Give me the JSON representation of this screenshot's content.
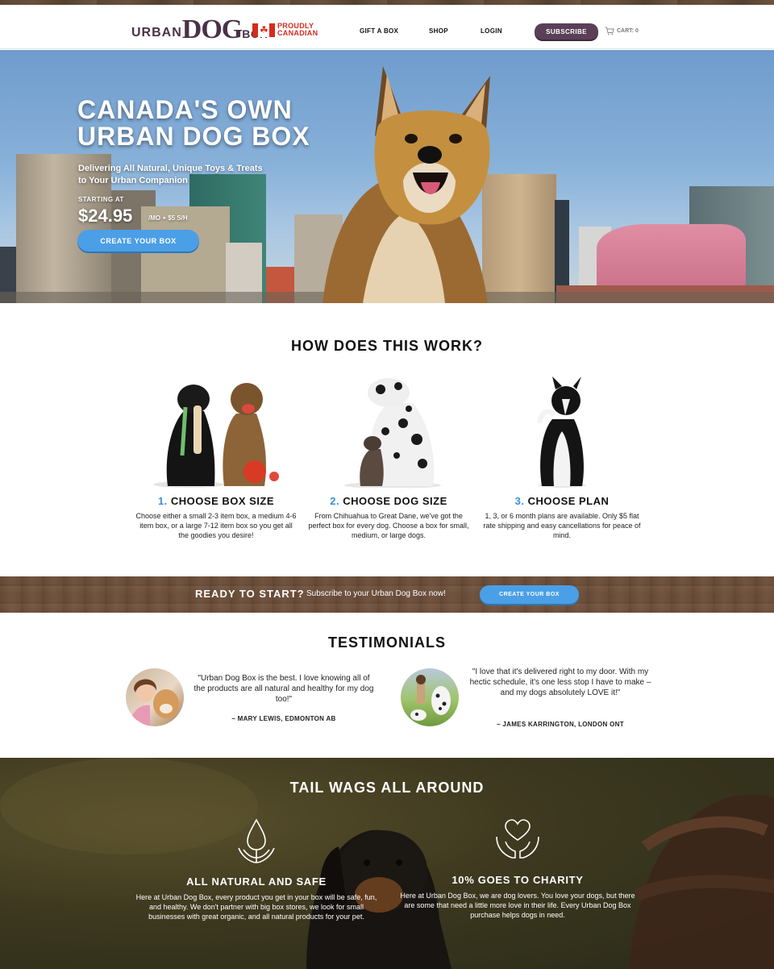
{
  "header": {
    "logo": {
      "urban": "URBAN",
      "dog": "DOG",
      "box": "BOX"
    },
    "badge": {
      "line1": "PROUDLY",
      "line2": "CANADIAN",
      "icon": "canada-flag-icon"
    },
    "nav": [
      "GIFT A BOX",
      "SHOP",
      "LOGIN"
    ],
    "subscribe_label": "SUBSCRIBE",
    "cart_label": "CART: 0",
    "cart_icon": "cart-icon"
  },
  "hero": {
    "title_line1": "CANADA'S OWN",
    "title_line2": "URBAN DOG BOX",
    "subtitle_line1": "Delivering All Natural, Unique Toys & Treats",
    "subtitle_line2": "to Your Urban Companion",
    "starting_at": "STARTING AT",
    "price": "$24.95",
    "price_suffix": "/MO + $5 S/H",
    "cta": "CREATE YOUR BOX"
  },
  "how": {
    "title": "HOW DOES THIS WORK?",
    "steps": [
      {
        "num": "1.",
        "title": "CHOOSE BOX SIZE",
        "body": "Choose either a small 2-3 item box, a medium 4-6 item box, or a large 7-12 item box so you get all the goodies you desire!"
      },
      {
        "num": "2.",
        "title": "CHOOSE DOG SIZE",
        "body": "From Chihuahua to Great Dane, we've got the perfect box for every dog. Choose a box for small, medium, or large dogs."
      },
      {
        "num": "3.",
        "title": "CHOOSE PLAN",
        "body": "1, 3, or 6 month plans are available. Only $5 flat rate shipping and easy cancellations for peace of mind."
      }
    ]
  },
  "ready": {
    "strong": "READY TO START?",
    "text": "Subscribe to your Urban Dog Box now!",
    "cta": "CREATE YOUR BOX"
  },
  "testimonials": {
    "title": "TESTIMONIALS",
    "items": [
      {
        "quote": "\"Urban Dog Box is the best. I love knowing all of the products are all natural and healthy for my dog too!\"",
        "author": "– MARY LEWIS, EDMONTON AB"
      },
      {
        "quote": "\"I love that it's delivered right to my door. With my hectic schedule, it's one less stop I have to make – and my dogs absolutely LOVE it!\"",
        "author": "– JAMES KARRINGTON, LONDON ONT"
      }
    ]
  },
  "tail": {
    "title": "TAIL WAGS ALL AROUND",
    "features": [
      {
        "icon": "water-drop-leaf-icon",
        "title": "ALL NATURAL AND SAFE",
        "body": "Here at Urban Dog Box, every product you get in your box will be safe, fun, and healthy. We don't partner with big box stores, we look for small businesses with great organic, and all natural products for your pet."
      },
      {
        "icon": "heart-hands-icon",
        "title": "10% GOES TO CHARITY",
        "body": "Here at Urban Dog Box, we are dog lovers. You love your dogs, but there are some that need a little more love in their life. Every Urban Dog Box purchase helps dogs in need."
      }
    ]
  }
}
